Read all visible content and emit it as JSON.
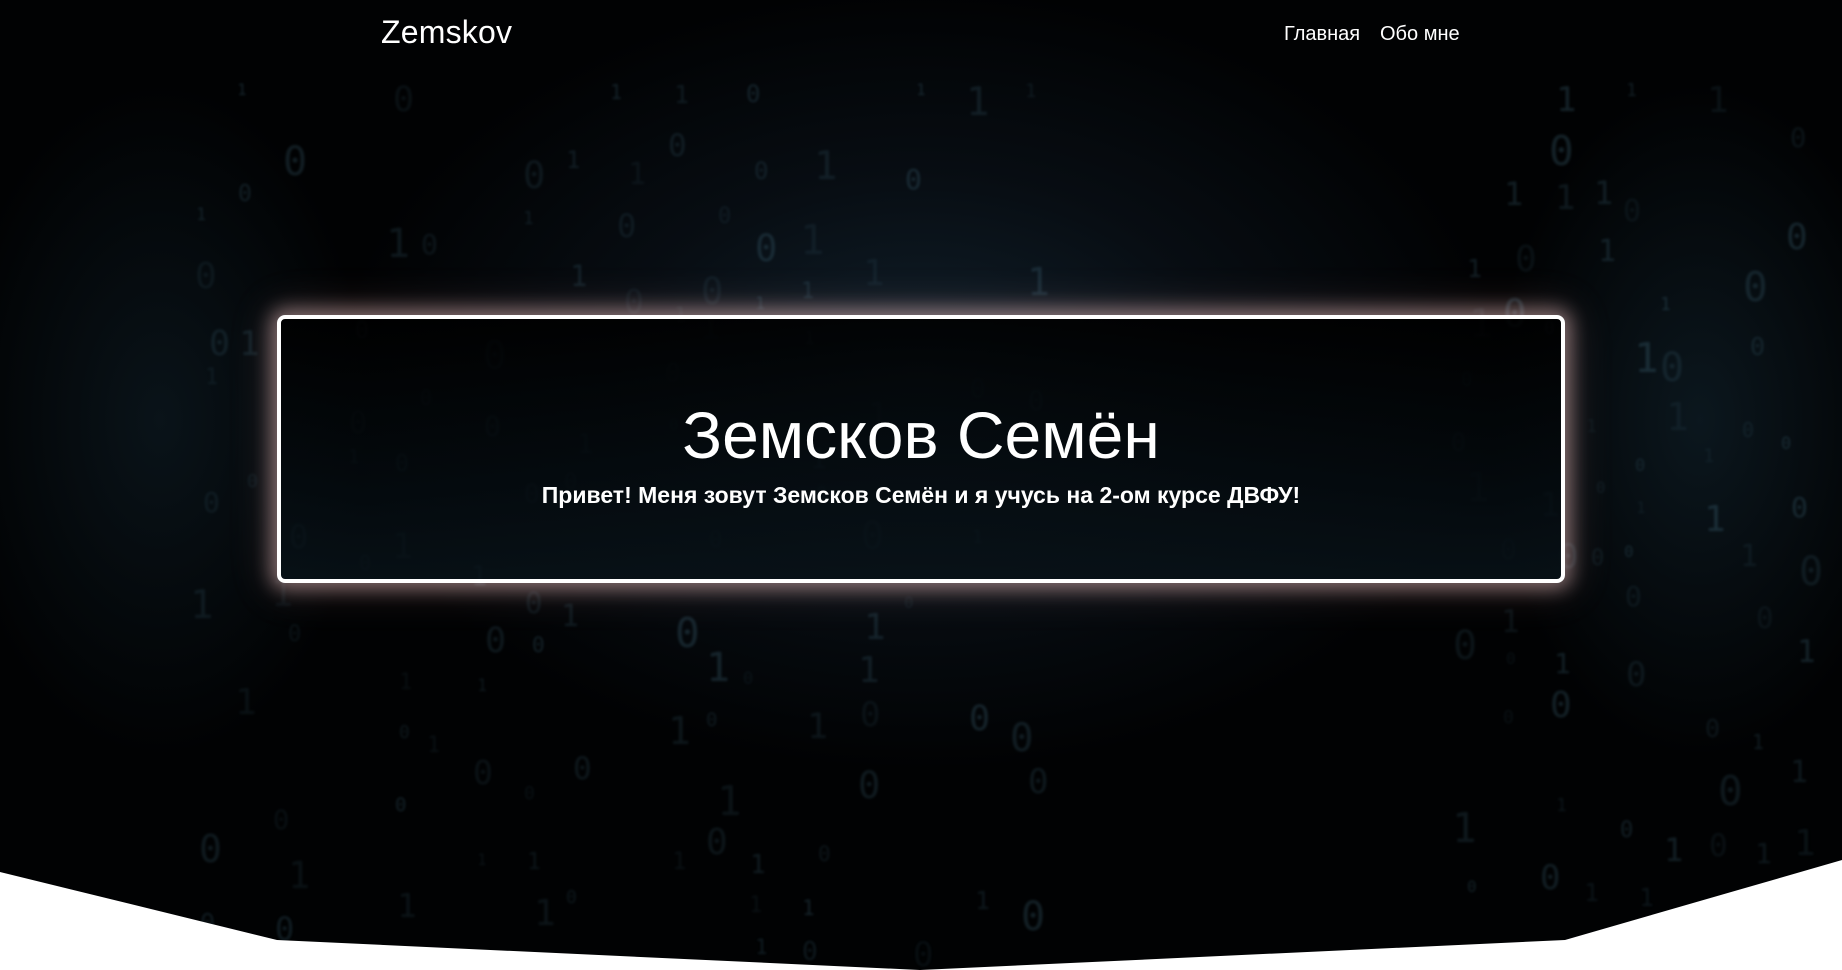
{
  "nav": {
    "brand": "Zemskov",
    "links": [
      {
        "label": "Главная"
      },
      {
        "label": "Обо мне"
      }
    ]
  },
  "hero": {
    "title": "Земсков Семён",
    "subtitle": "Привет! Меня зовут Земсков Семён и я учусь на 2-ом курсе ДВФУ!"
  },
  "colors": {
    "background": "#010203",
    "text": "#ffffff",
    "card_border": "#ffffff",
    "card_glow": "#ffd2d2"
  }
}
